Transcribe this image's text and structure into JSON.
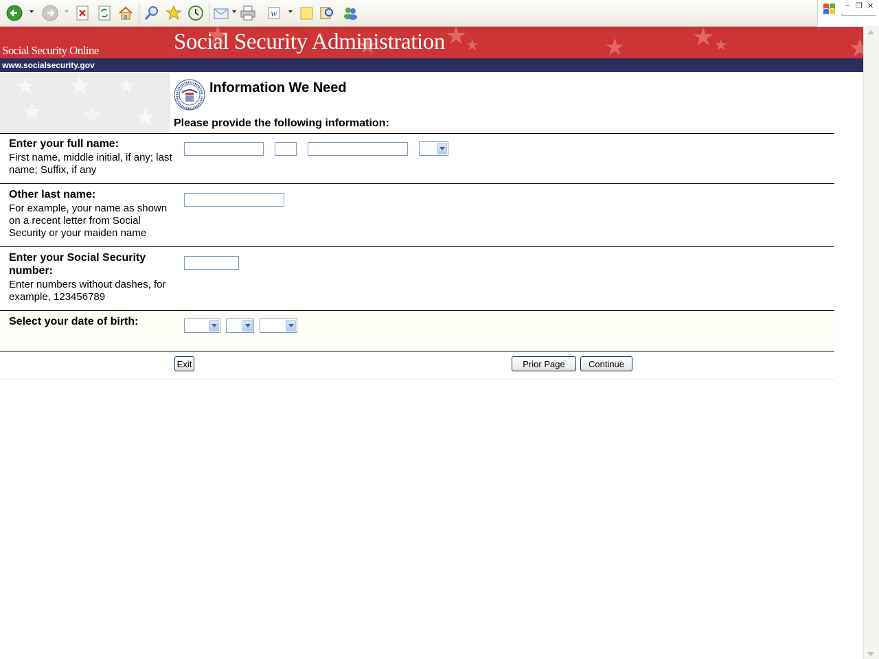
{
  "browser": {
    "toolbar_icons": [
      "back-icon",
      "forward-icon",
      "stop-icon",
      "refresh-icon",
      "home-icon",
      "search-icon",
      "favorites-icon",
      "history-icon",
      "mail-icon",
      "print-icon",
      "edit-icon",
      "discuss-icon",
      "research-icon",
      "messenger-icon"
    ],
    "window_controls": {
      "minimize": "–",
      "restore": "❐",
      "close": "✕"
    }
  },
  "banner": {
    "site_name": "Social Security Online",
    "agency_name": "Social Security Administration",
    "url": "www.socialsecurity.gov",
    "colors": {
      "banner_red": "#cd3435",
      "url_bar_navy": "#2d2f60"
    }
  },
  "page": {
    "title": "Information We Need",
    "instructions": "Please provide the following information:",
    "seal_text": "SOCIAL SECURITY ADMINISTRATION USA"
  },
  "form": {
    "full_name": {
      "label": "Enter your full name:",
      "help": "First name, middle initial, if any; last name; Suffix, if any",
      "first": "",
      "middle": "",
      "last": "",
      "suffix": ""
    },
    "other_last_name": {
      "label": "Other last name:",
      "help": "For example, your name as shown on a recent letter from Social Security or your maiden name",
      "value": ""
    },
    "ssn": {
      "label": "Enter your Social Security number:",
      "help": "Enter numbers without dashes, for example, 123456789",
      "value": ""
    },
    "dob": {
      "label": "Select your date of birth:",
      "month": "",
      "day": "",
      "year": ""
    }
  },
  "buttons": {
    "exit": "Exit",
    "prior": "Prior Page",
    "continue": "Continue"
  }
}
